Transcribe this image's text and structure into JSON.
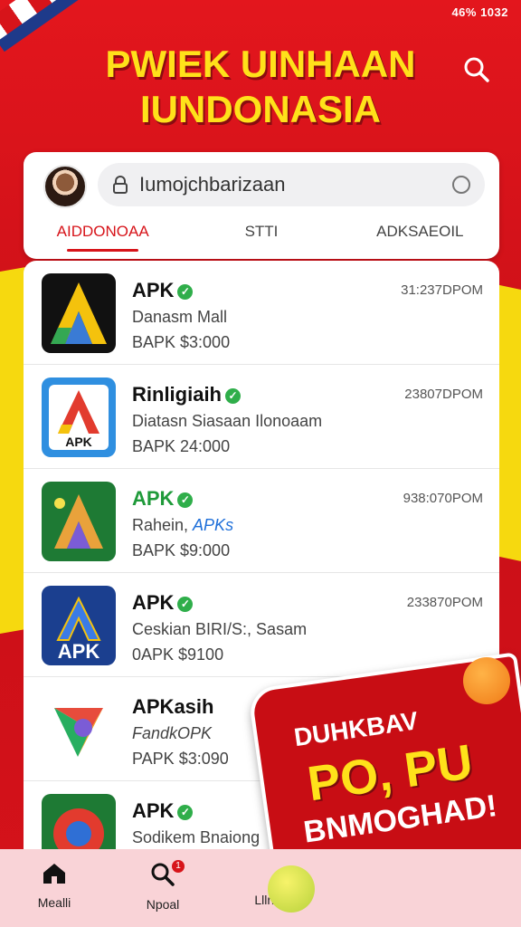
{
  "status_bar": {
    "text": "46% 1032"
  },
  "header": {
    "title_line1": "PWIEK UINHAAN",
    "title_line2": "IUNDONASIA"
  },
  "search": {
    "value": "Iumojchbarizaan"
  },
  "tabs": [
    {
      "label": "AIDDONOAA",
      "active": true
    },
    {
      "label": "STTI",
      "active": false
    },
    {
      "label": "ADKSAEOIL",
      "active": false
    }
  ],
  "items": [
    {
      "name": "APK",
      "desc": "Danasm Mall",
      "price": "BAPK $3:000",
      "date": "31:237DPOM",
      "icon": "apk-dark-icon",
      "green": false
    },
    {
      "name": "Rinligiaih",
      "desc": "Diatasn Siasaan Ilonoaam",
      "price": "BAPK 24:000",
      "date": "23807DPOM",
      "icon": "apk-blue-icon",
      "green": false
    },
    {
      "name": "APK",
      "desc_a": "Rahein, ",
      "desc_b": "APKs",
      "price": "BAPK $9:000",
      "date": "938:070POM",
      "icon": "apk-green-icon",
      "green": true
    },
    {
      "name": "APK",
      "desc": "Ceskian BIRI/S:, Sasam",
      "price": "0APK $9100",
      "date": "233870POM",
      "icon": "apk-navy-icon",
      "green": false
    },
    {
      "name": "APKasih",
      "desc_green": "FandkOPK",
      "price": "PAPK $3:090",
      "date": "",
      "icon": "apk-swirl-icon",
      "green": false
    },
    {
      "name": "APK",
      "desc": "Sodikem Bnaiong",
      "price": "",
      "date": "",
      "icon": "apk-red-icon",
      "green": false
    }
  ],
  "promo": {
    "line1": "DUHKBAV",
    "line2": "PO, PU",
    "line3": "BNMOGHAD!"
  },
  "bottom_nav": [
    {
      "label": "Mealli",
      "icon": "home-icon",
      "badge": ""
    },
    {
      "label": "Npoal",
      "icon": "search-icon",
      "badge": "1"
    },
    {
      "label": "Lllrmy",
      "icon": "smile-icon",
      "badge": ""
    }
  ],
  "colors": {
    "brand_red": "#d7141a",
    "accent_yellow": "#ffe11a",
    "verified_green": "#2fae4a"
  }
}
